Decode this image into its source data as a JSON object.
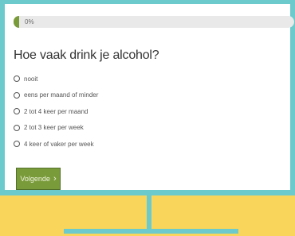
{
  "progress": {
    "label": "0%",
    "value": 0
  },
  "question": {
    "title": "Hoe vaak drink je alcohol?"
  },
  "options": [
    {
      "label": "nooit"
    },
    {
      "label": "eens per maand of minder"
    },
    {
      "label": "2 tot 4 keer per maand"
    },
    {
      "label": "2 tot 3 keer per week"
    },
    {
      "label": "4 keer of vaker per week"
    }
  ],
  "navigation": {
    "next_label": "Volgende",
    "next_icon": "chevron-right-icon"
  },
  "colors": {
    "accent": "#7a9b3a",
    "frame": "#6cc9cc",
    "background": "#f9d55b"
  }
}
